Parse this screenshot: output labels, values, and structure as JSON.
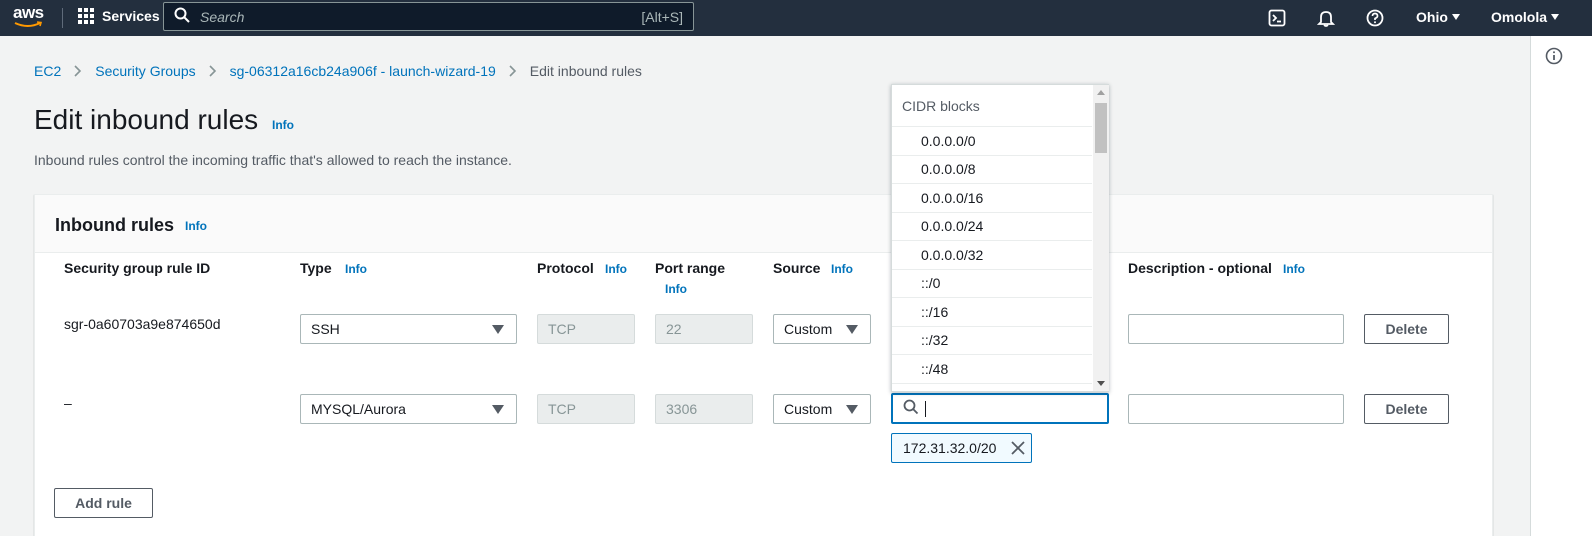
{
  "topnav": {
    "logo_text": "aws",
    "services_label": "Services",
    "search_placeholder": "Search",
    "search_shortcut": "[Alt+S]",
    "region": "Ohio",
    "user": "Omolola"
  },
  "breadcrumb": {
    "items": [
      "EC2",
      "Security Groups",
      "sg-06312a16cb24a906f - launch-wizard-19"
    ],
    "current": "Edit inbound rules"
  },
  "page": {
    "title": "Edit inbound rules",
    "info": "Info",
    "description": "Inbound rules control the incoming traffic that's allowed to reach the instance."
  },
  "panel": {
    "title": "Inbound rules",
    "info": "Info",
    "columns": {
      "rule_id": "Security group rule ID",
      "type": "Type",
      "protocol": "Protocol",
      "port_range": "Port range",
      "source": "Source",
      "description": "Description - optional",
      "info": "Info"
    },
    "rows": [
      {
        "rule_id": "sgr-0a60703a9e874650d",
        "type": "SSH",
        "protocol": "TCP",
        "port": "22",
        "source": "Custom",
        "delete": "Delete"
      },
      {
        "rule_id": "–",
        "type": "MYSQL/Aurora",
        "protocol": "TCP",
        "port": "3306",
        "source": "Custom",
        "delete": "Delete"
      }
    ],
    "add_rule": "Add rule"
  },
  "cidr_dropdown": {
    "group_label": "CIDR blocks",
    "options": [
      "0.0.0.0/0",
      "0.0.0.0/8",
      "0.0.0.0/16",
      "0.0.0.0/24",
      "0.0.0.0/32",
      "::/0",
      "::/16",
      "::/32",
      "::/48"
    ]
  },
  "token": {
    "value": "172.31.32.0/20"
  },
  "colors": {
    "nav_bg": "#232f3e",
    "link": "#0073bb",
    "focus": "#0073bb"
  }
}
